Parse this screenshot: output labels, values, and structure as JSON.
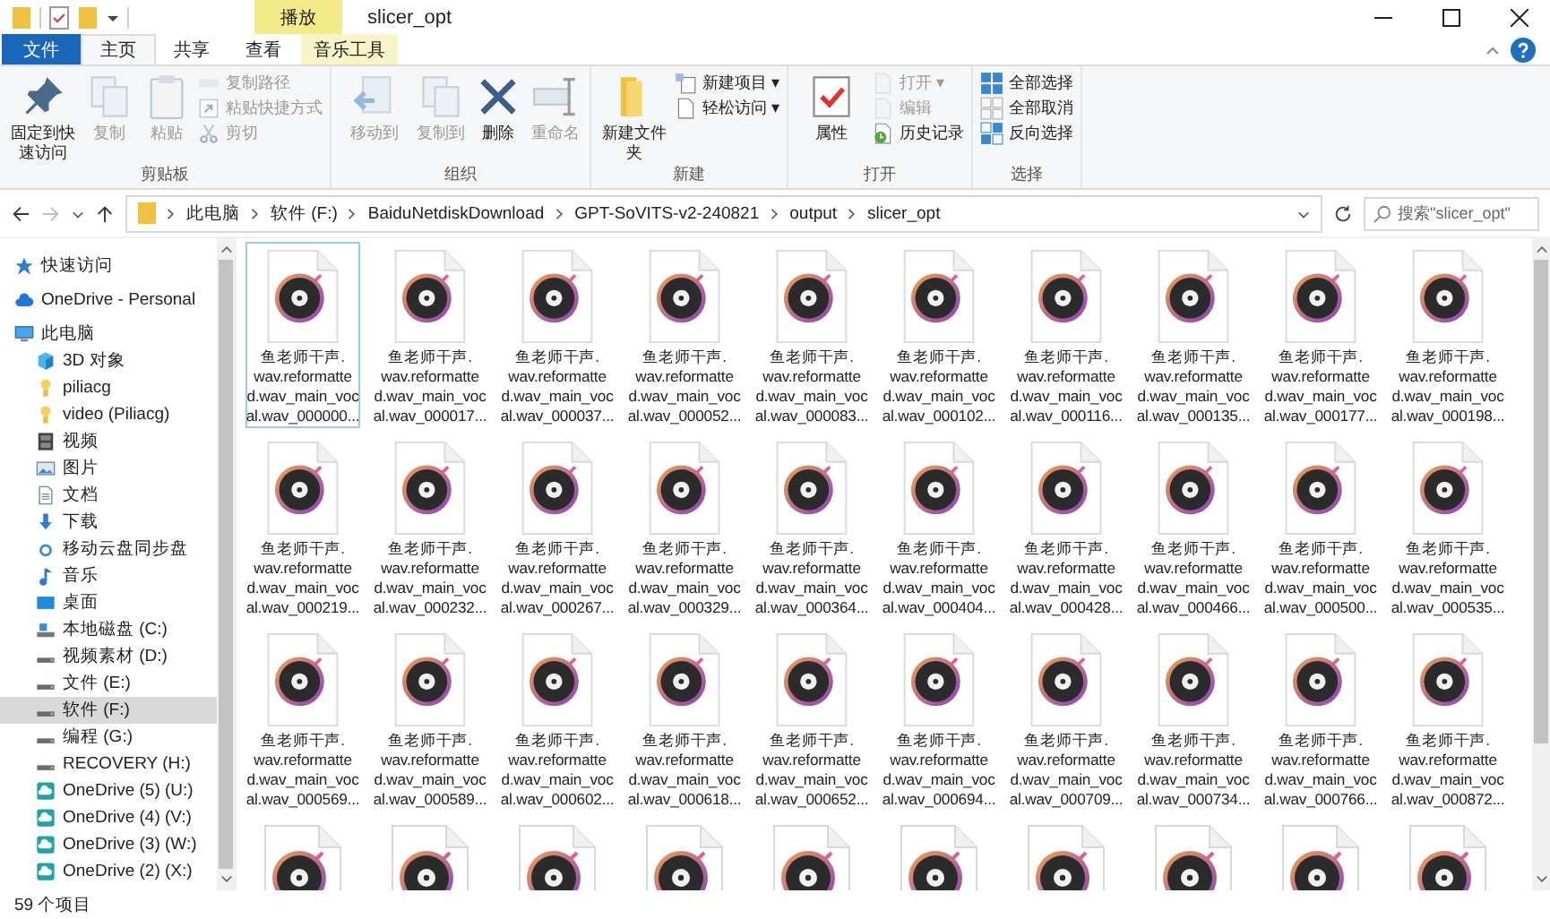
{
  "window": {
    "title": "slicer_opt",
    "context_tab": "播放"
  },
  "tabs": [
    {
      "label": "文件",
      "kind": "file",
      "selected": false
    },
    {
      "label": "主页",
      "kind": "normal",
      "selected": true
    },
    {
      "label": "共享",
      "kind": "normal",
      "selected": false
    },
    {
      "label": "查看",
      "kind": "normal",
      "selected": false
    },
    {
      "label": "音乐工具",
      "kind": "context",
      "selected": false
    }
  ],
  "ribbon": {
    "groups": [
      {
        "label": "剪贴板",
        "large_buttons": [
          {
            "label": "固定到快速访问",
            "kind": "pin",
            "disabled": false
          },
          {
            "label": "复制",
            "kind": "copy",
            "disabled": true
          },
          {
            "label": "粘贴",
            "kind": "paste",
            "disabled": true
          }
        ],
        "small_buttons": [
          {
            "label": "复制路径",
            "kind": "path",
            "disabled": true
          },
          {
            "label": "粘贴快捷方式",
            "kind": "shortcut",
            "disabled": true
          },
          {
            "label": "剪切",
            "kind": "cut",
            "disabled": true
          }
        ]
      },
      {
        "label": "组织",
        "large_buttons": [
          {
            "label": "移动到",
            "kind": "move",
            "disabled": true
          },
          {
            "label": "复制到",
            "kind": "copyto",
            "disabled": true
          },
          {
            "label": "删除",
            "kind": "delete",
            "disabled": false
          },
          {
            "label": "重命名",
            "kind": "rename",
            "disabled": true
          }
        ]
      },
      {
        "label": "新建",
        "large_buttons": [
          {
            "label": "新建文件夹",
            "kind": "folder",
            "disabled": false
          }
        ],
        "small_buttons": [
          {
            "label": "新建项目 ▾",
            "kind": "newitem",
            "disabled": false
          },
          {
            "label": "轻松访问 ▾",
            "kind": "easy",
            "disabled": false
          }
        ]
      },
      {
        "label": "打开",
        "large_buttons": [
          {
            "label": "属性",
            "kind": "props",
            "disabled": false
          }
        ],
        "small_buttons": [
          {
            "label": "打开 ▾",
            "kind": "open",
            "disabled": true
          },
          {
            "label": "编辑",
            "kind": "edit",
            "disabled": true
          },
          {
            "label": "历史记录",
            "kind": "history",
            "disabled": false
          }
        ]
      },
      {
        "label": "选择",
        "small_buttons": [
          {
            "label": "全部选择",
            "kind": "selectall",
            "disabled": false
          },
          {
            "label": "全部取消",
            "kind": "selectnone",
            "disabled": false
          },
          {
            "label": "反向选择",
            "kind": "invert",
            "disabled": false
          }
        ]
      }
    ]
  },
  "address": {
    "crumbs": [
      "此电脑",
      "软件 (F:)",
      "BaiduNetdiskDownload",
      "GPT-SoVITS-v2-240821",
      "output",
      "slicer_opt"
    ]
  },
  "search": {
    "placeholder": "搜索\"slicer_opt\""
  },
  "sidebar": {
    "items": [
      {
        "label": "快速访问",
        "kind": "star",
        "selected": false
      },
      {
        "label": "OneDrive - Personal",
        "kind": "cloud",
        "selected": false
      },
      {
        "label": "此电脑",
        "kind": "pc",
        "selected": false,
        "children": [
          {
            "label": "3D 对象",
            "kind": "cube",
            "selected": false
          },
          {
            "label": "piliacg",
            "kind": "user",
            "selected": false
          },
          {
            "label": "video (Piliacg)",
            "kind": "user",
            "selected": false
          },
          {
            "label": "视频",
            "kind": "video",
            "selected": false
          },
          {
            "label": "图片",
            "kind": "picture",
            "selected": false
          },
          {
            "label": "文档",
            "kind": "doc",
            "selected": false
          },
          {
            "label": "下载",
            "kind": "download",
            "selected": false
          },
          {
            "label": "移动云盘同步盘",
            "kind": "sync",
            "selected": false
          },
          {
            "label": "音乐",
            "kind": "music",
            "selected": false
          },
          {
            "label": "桌面",
            "kind": "desktop",
            "selected": false
          },
          {
            "label": "本地磁盘 (C:)",
            "kind": "sysdrive",
            "selected": false
          },
          {
            "label": "视频素材 (D:)",
            "kind": "drive",
            "selected": false
          },
          {
            "label": "文件 (E:)",
            "kind": "drive",
            "selected": false
          },
          {
            "label": "软件 (F:)",
            "kind": "drive",
            "selected": true
          },
          {
            "label": "编程 (G:)",
            "kind": "drive",
            "selected": false
          },
          {
            "label": "RECOVERY (H:)",
            "kind": "drive",
            "selected": false
          },
          {
            "label": "OneDrive (5) (U:)",
            "kind": "netdrive",
            "selected": false
          },
          {
            "label": "OneDrive (4) (V:)",
            "kind": "netdrive",
            "selected": false
          },
          {
            "label": "OneDrive (3) (W:)",
            "kind": "netdrive",
            "selected": false
          },
          {
            "label": "OneDrive (2) (X:)",
            "kind": "netdrive",
            "selected": false
          }
        ]
      }
    ]
  },
  "files": [
    {
      "kind": "audio",
      "selected": true,
      "name_lines": [
        "鱼老师干声.",
        "wav.reformatte",
        "d.wav_main_voc",
        "al.wav_000000..."
      ]
    },
    {
      "kind": "audio",
      "selected": false,
      "name_lines": [
        "鱼老师干声.",
        "wav.reformatte",
        "d.wav_main_voc",
        "al.wav_000017..."
      ]
    },
    {
      "kind": "audio",
      "selected": false,
      "name_lines": [
        "鱼老师干声.",
        "wav.reformatte",
        "d.wav_main_voc",
        "al.wav_000037..."
      ]
    },
    {
      "kind": "audio",
      "selected": false,
      "name_lines": [
        "鱼老师干声.",
        "wav.reformatte",
        "d.wav_main_voc",
        "al.wav_000052..."
      ]
    },
    {
      "kind": "audio",
      "selected": false,
      "name_lines": [
        "鱼老师干声.",
        "wav.reformatte",
        "d.wav_main_voc",
        "al.wav_000083..."
      ]
    },
    {
      "kind": "audio",
      "selected": false,
      "name_lines": [
        "鱼老师干声.",
        "wav.reformatte",
        "d.wav_main_voc",
        "al.wav_000102..."
      ]
    },
    {
      "kind": "audio",
      "selected": false,
      "name_lines": [
        "鱼老师干声.",
        "wav.reformatte",
        "d.wav_main_voc",
        "al.wav_000116..."
      ]
    },
    {
      "kind": "audio",
      "selected": false,
      "name_lines": [
        "鱼老师干声.",
        "wav.reformatte",
        "d.wav_main_voc",
        "al.wav_000135..."
      ]
    },
    {
      "kind": "audio",
      "selected": false,
      "name_lines": [
        "鱼老师干声.",
        "wav.reformatte",
        "d.wav_main_voc",
        "al.wav_000177..."
      ]
    },
    {
      "kind": "audio",
      "selected": false,
      "name_lines": [
        "鱼老师干声.",
        "wav.reformatte",
        "d.wav_main_voc",
        "al.wav_000198..."
      ]
    },
    {
      "kind": "audio",
      "selected": false,
      "name_lines": [
        "鱼老师干声.",
        "wav.reformatte",
        "d.wav_main_voc",
        "al.wav_000219..."
      ]
    },
    {
      "kind": "audio",
      "selected": false,
      "name_lines": [
        "鱼老师干声.",
        "wav.reformatte",
        "d.wav_main_voc",
        "al.wav_000232..."
      ]
    },
    {
      "kind": "audio",
      "selected": false,
      "name_lines": [
        "鱼老师干声.",
        "wav.reformatte",
        "d.wav_main_voc",
        "al.wav_000267..."
      ]
    },
    {
      "kind": "audio",
      "selected": false,
      "name_lines": [
        "鱼老师干声.",
        "wav.reformatte",
        "d.wav_main_voc",
        "al.wav_000329..."
      ]
    },
    {
      "kind": "audio",
      "selected": false,
      "name_lines": [
        "鱼老师干声.",
        "wav.reformatte",
        "d.wav_main_voc",
        "al.wav_000364..."
      ]
    },
    {
      "kind": "audio",
      "selected": false,
      "name_lines": [
        "鱼老师干声.",
        "wav.reformatte",
        "d.wav_main_voc",
        "al.wav_000404..."
      ]
    },
    {
      "kind": "audio",
      "selected": false,
      "name_lines": [
        "鱼老师干声.",
        "wav.reformatte",
        "d.wav_main_voc",
        "al.wav_000428..."
      ]
    },
    {
      "kind": "audio",
      "selected": false,
      "name_lines": [
        "鱼老师干声.",
        "wav.reformatte",
        "d.wav_main_voc",
        "al.wav_000466..."
      ]
    },
    {
      "kind": "audio",
      "selected": false,
      "name_lines": [
        "鱼老师干声.",
        "wav.reformatte",
        "d.wav_main_voc",
        "al.wav_000500..."
      ]
    },
    {
      "kind": "audio",
      "selected": false,
      "name_lines": [
        "鱼老师干声.",
        "wav.reformatte",
        "d.wav_main_voc",
        "al.wav_000535..."
      ]
    },
    {
      "kind": "audio",
      "selected": false,
      "name_lines": [
        "鱼老师干声.",
        "wav.reformatte",
        "d.wav_main_voc",
        "al.wav_000569..."
      ]
    },
    {
      "kind": "audio",
      "selected": false,
      "name_lines": [
        "鱼老师干声.",
        "wav.reformatte",
        "d.wav_main_voc",
        "al.wav_000589..."
      ]
    },
    {
      "kind": "audio",
      "selected": false,
      "name_lines": [
        "鱼老师干声.",
        "wav.reformatte",
        "d.wav_main_voc",
        "al.wav_000602..."
      ]
    },
    {
      "kind": "audio",
      "selected": false,
      "name_lines": [
        "鱼老师干声.",
        "wav.reformatte",
        "d.wav_main_voc",
        "al.wav_000618..."
      ]
    },
    {
      "kind": "audio",
      "selected": false,
      "name_lines": [
        "鱼老师干声.",
        "wav.reformatte",
        "d.wav_main_voc",
        "al.wav_000652..."
      ]
    },
    {
      "kind": "audio",
      "selected": false,
      "name_lines": [
        "鱼老师干声.",
        "wav.reformatte",
        "d.wav_main_voc",
        "al.wav_000694..."
      ]
    },
    {
      "kind": "audio",
      "selected": false,
      "name_lines": [
        "鱼老师干声.",
        "wav.reformatte",
        "d.wav_main_voc",
        "al.wav_000709..."
      ]
    },
    {
      "kind": "audio",
      "selected": false,
      "name_lines": [
        "鱼老师干声.",
        "wav.reformatte",
        "d.wav_main_voc",
        "al.wav_000734..."
      ]
    },
    {
      "kind": "audio",
      "selected": false,
      "name_lines": [
        "鱼老师干声.",
        "wav.reformatte",
        "d.wav_main_voc",
        "al.wav_000766..."
      ]
    },
    {
      "kind": "audio",
      "selected": false,
      "name_lines": [
        "鱼老师干声.",
        "wav.reformatte",
        "d.wav_main_voc",
        "al.wav_000872..."
      ]
    },
    {
      "kind": "audio",
      "selected": false
    },
    {
      "kind": "audio",
      "selected": false
    },
    {
      "kind": "audio",
      "selected": false
    },
    {
      "kind": "audio",
      "selected": false
    },
    {
      "kind": "audio",
      "selected": false
    },
    {
      "kind": "audio",
      "selected": false
    },
    {
      "kind": "audio",
      "selected": false
    },
    {
      "kind": "audio",
      "selected": false
    },
    {
      "kind": "audio",
      "selected": false
    },
    {
      "kind": "audio",
      "selected": false
    }
  ],
  "status_bar": {
    "item_count": "59 个项目"
  }
}
